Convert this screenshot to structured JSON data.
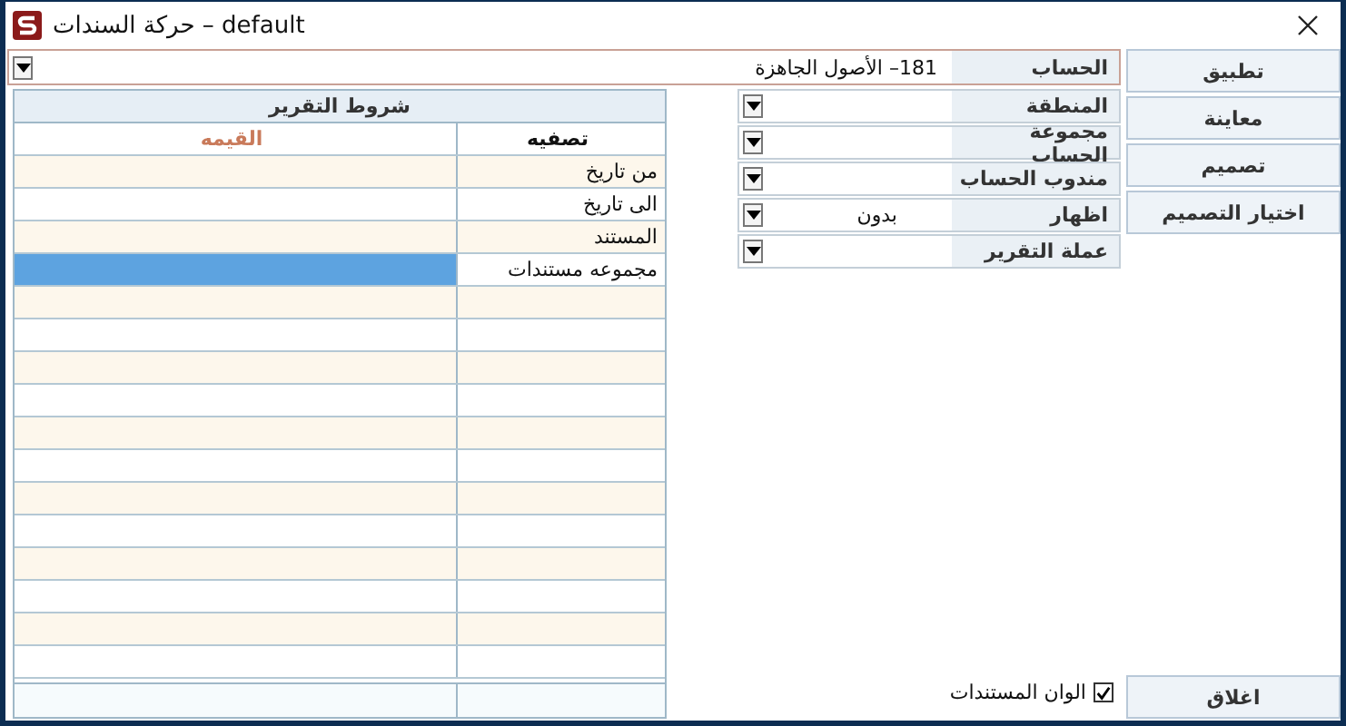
{
  "window": {
    "title": "حركة السندات – default"
  },
  "account": {
    "label": "الحساب",
    "value": "181– الأصول الجاهزة"
  },
  "filters": [
    {
      "label": "المنطقة"
    },
    {
      "label": "مجموعة الحساب"
    },
    {
      "label": "مندوب الحساب"
    },
    {
      "label": "اظهار",
      "value": "بدون"
    },
    {
      "label": "عملة التقرير"
    }
  ],
  "conditions": {
    "title": "شروط التقرير",
    "columns": [
      "تصفيه",
      "القيمه"
    ],
    "rows": [
      {
        "filter": "من تاريخ",
        "selected": false
      },
      {
        "filter": "الى تاريخ",
        "selected": false
      },
      {
        "filter": "المستند",
        "selected": false
      },
      {
        "filter": "مجموعه مستندات",
        "selected": true
      }
    ]
  },
  "buttons": [
    "تطبيق",
    "معاينة",
    "تصميم",
    "اختيار التصميم"
  ],
  "colors_option": {
    "label": "الوان المستندات",
    "checked": true
  },
  "close_button": "اغلاق"
}
